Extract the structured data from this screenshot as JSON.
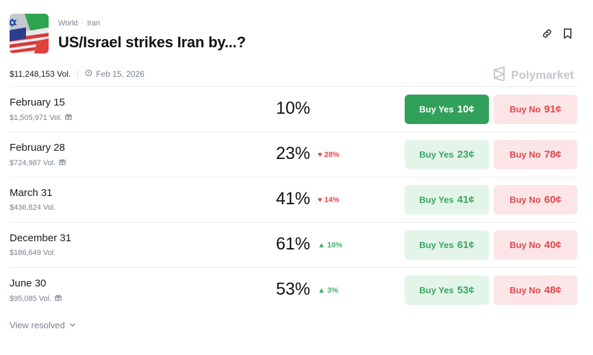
{
  "header": {
    "breadcrumb": [
      "World",
      "Iran"
    ],
    "title": "US/Israel strikes Iran by...?",
    "actions": [
      "link-icon",
      "bookmark-icon"
    ]
  },
  "meta": {
    "volume": "$11,248,153 Vol.",
    "date": "Feb 15, 2026",
    "brand": "Polymarket"
  },
  "markets": [
    {
      "label": "February 15",
      "volume": "$1,505,971 Vol.",
      "gift": true,
      "percent": "10%",
      "change": "",
      "change_dir": "",
      "yes_label": "Buy Yes",
      "yes_price": "10¢",
      "no_label": "Buy No",
      "no_price": "91¢",
      "yes_active": true
    },
    {
      "label": "February 28",
      "volume": "$724,987 Vol.",
      "gift": true,
      "percent": "23%",
      "change": "28%",
      "change_dir": "down",
      "yes_label": "Buy Yes",
      "yes_price": "23¢",
      "no_label": "Buy No",
      "no_price": "78¢",
      "yes_active": false
    },
    {
      "label": "March 31",
      "volume": "$436,824 Vol.",
      "gift": false,
      "percent": "41%",
      "change": "14%",
      "change_dir": "down",
      "yes_label": "Buy Yes",
      "yes_price": "41¢",
      "no_label": "Buy No",
      "no_price": "60¢",
      "yes_active": false
    },
    {
      "label": "December 31",
      "volume": "$186,649 Vol.",
      "gift": false,
      "percent": "61%",
      "change": "10%",
      "change_dir": "up",
      "yes_label": "Buy Yes",
      "yes_price": "61¢",
      "no_label": "Buy No",
      "no_price": "40¢",
      "yes_active": false
    },
    {
      "label": "June 30",
      "volume": "$95,085 Vol.",
      "gift": true,
      "percent": "53%",
      "change": "3%",
      "change_dir": "up",
      "yes_label": "Buy Yes",
      "yes_price": "53¢",
      "no_label": "Buy No",
      "no_price": "48¢",
      "yes_active": false
    }
  ],
  "footer": {
    "view_resolved": "View resolved"
  },
  "colors": {
    "yes": "#3aa761",
    "yes_active_bg": "#31a05a",
    "no": "#de4a4e",
    "down": "#e0474c",
    "up": "#3dae66"
  }
}
